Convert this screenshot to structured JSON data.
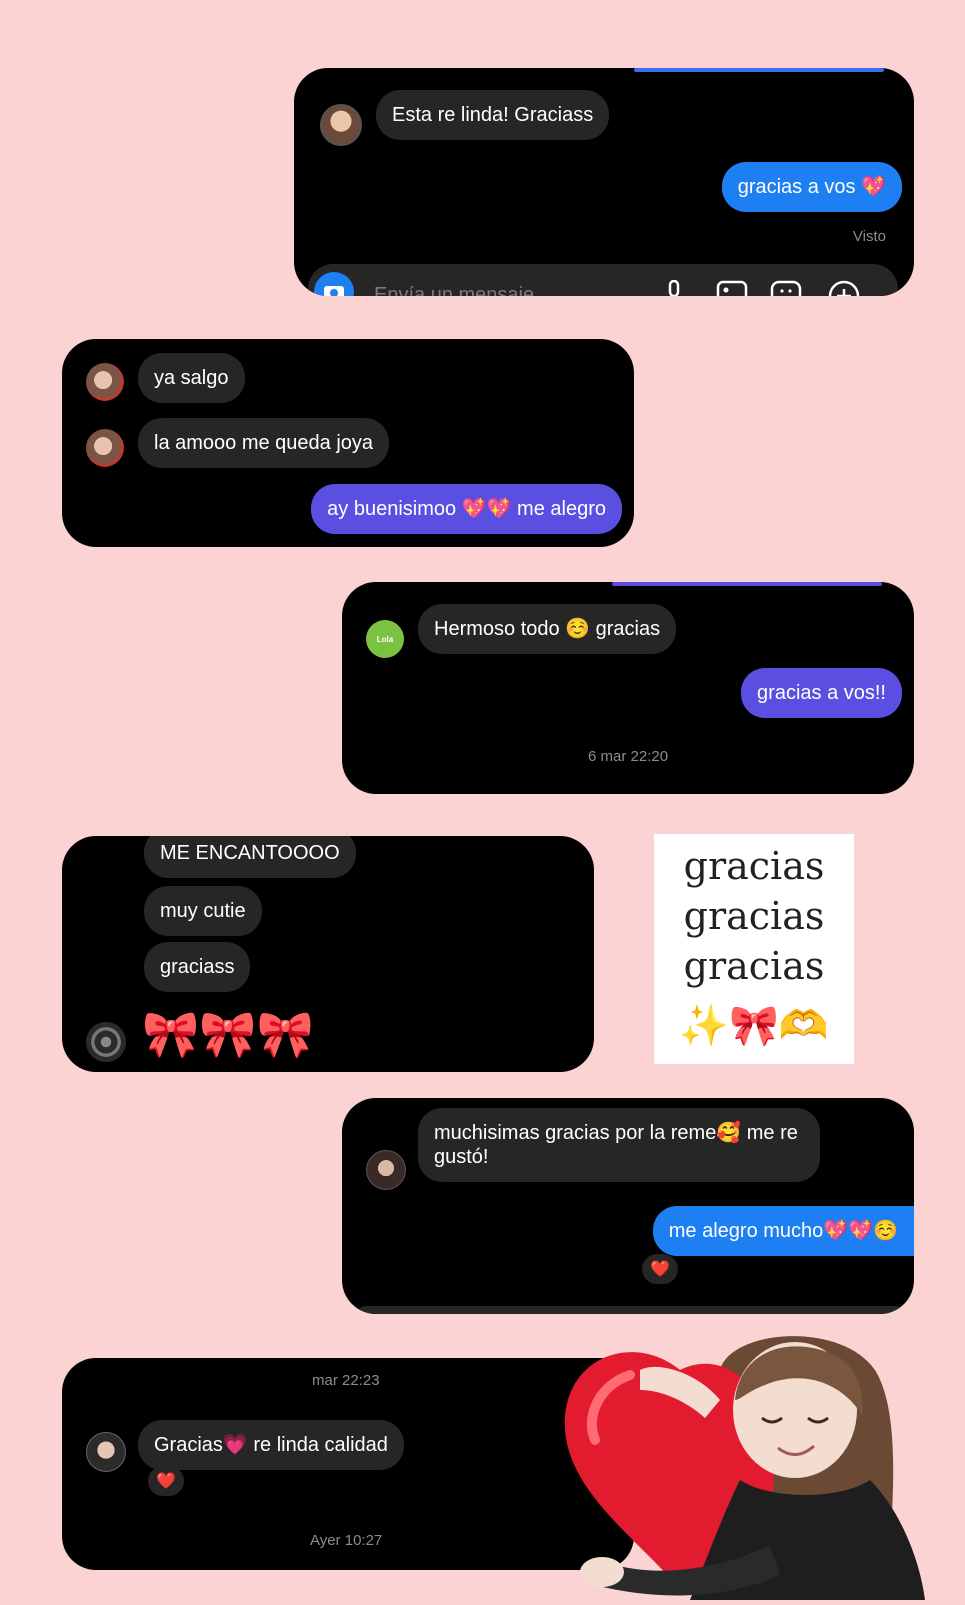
{
  "colors": {
    "background": "#fbd3d3",
    "card": "#000000",
    "bubble_received": "#262626",
    "bubble_sent_blue": "#1d7ff2",
    "bubble_sent_purple": "#5a4fe0",
    "heart": "#e31b2e"
  },
  "chat1": {
    "received": "Esta re linda! Graciass",
    "sent": "gracias a vos 💖",
    "seen": "Visto",
    "composer_placeholder": "Envía un mensaje..."
  },
  "chat2": {
    "received1": "ya salgo",
    "received2": "la amooo me queda joya",
    "sent": "ay buenisimoo 💖💖 me alegro"
  },
  "chat3": {
    "received": "Hermoso todo ☺️ gracias",
    "sent": "gracias a vos!!",
    "timestamp": "6 mar 22:20",
    "avatar_text": "Lola"
  },
  "chat4": {
    "messages": [
      "ME ENCANTOOOO",
      "muy cutie",
      "graciass"
    ],
    "emoji": "🎀🎀🎀"
  },
  "sticker": {
    "lines": [
      "gracias",
      "gracias",
      "gracias"
    ],
    "emoji": "✨🎀🫶"
  },
  "chat5": {
    "received": "muchisimas gracias por la reme🥰 me re gustó!",
    "sent": "me alegro mucho💖💖☺️",
    "reaction": "❤️"
  },
  "chat6": {
    "timestamp_top": "mar 22:23",
    "received": "Gracias💗 re linda calidad",
    "reaction": "❤️",
    "timestamp_bottom": "Ayer 10:27"
  }
}
